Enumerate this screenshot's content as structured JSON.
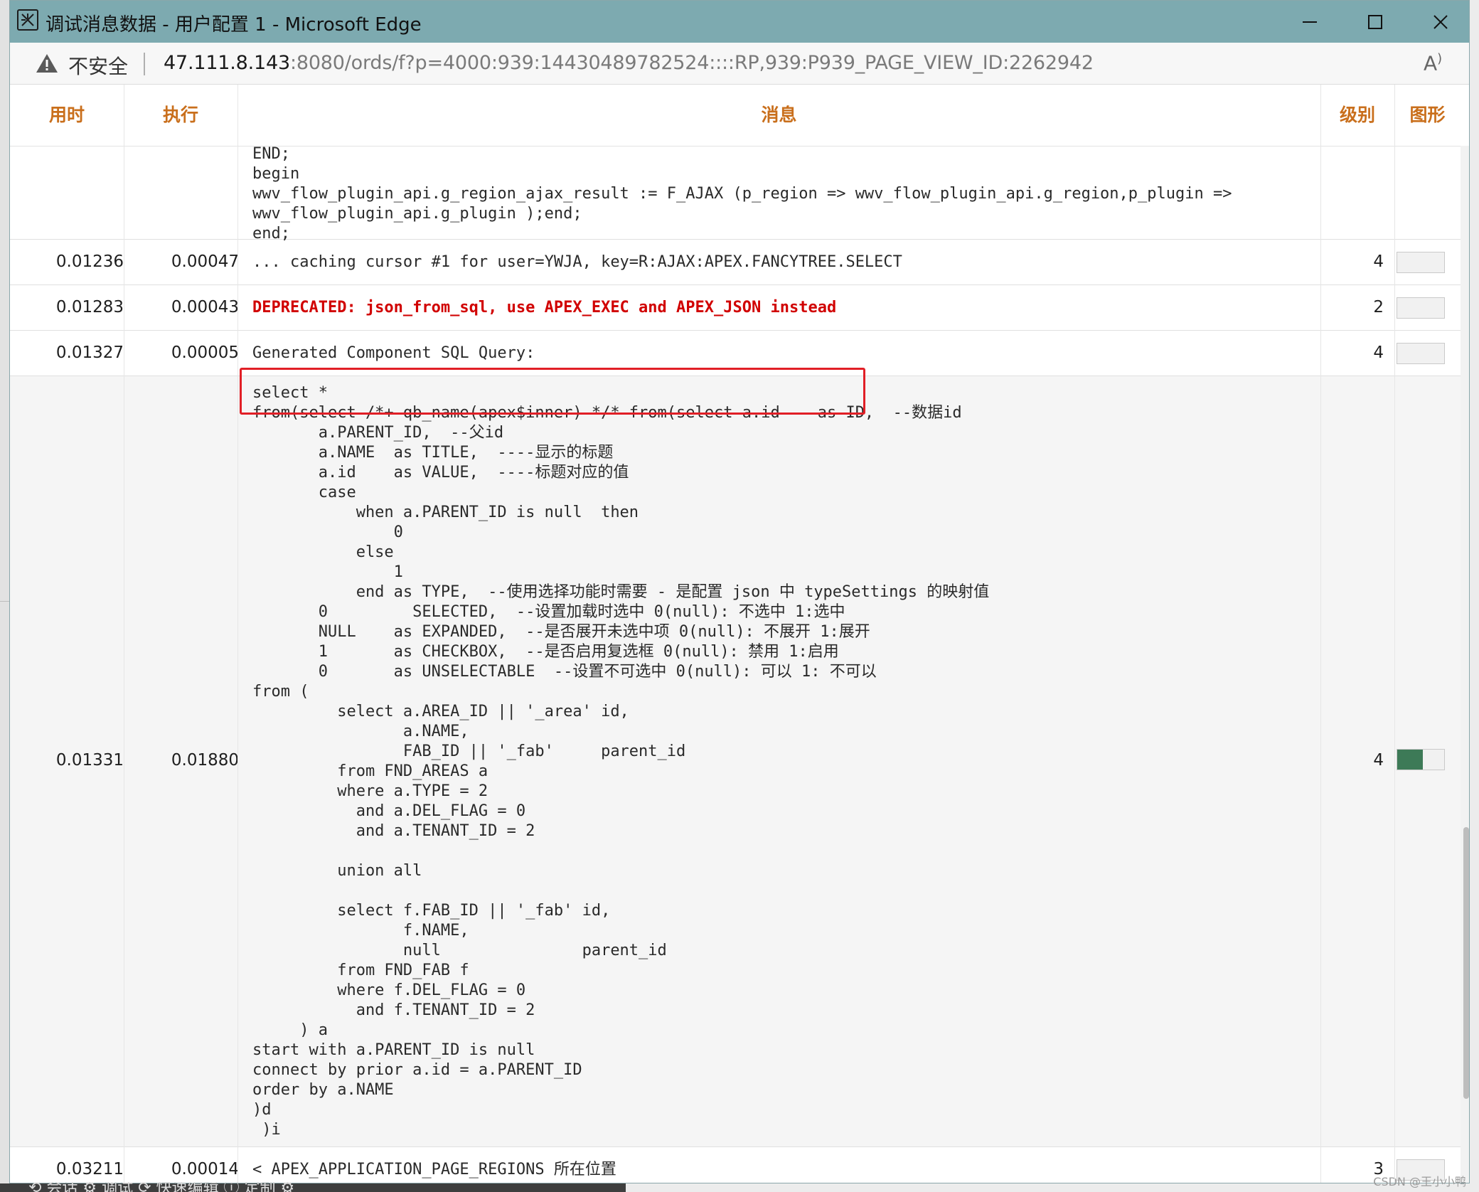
{
  "window": {
    "title": "调试消息数据 - 用户配置 1 - Microsoft Edge"
  },
  "addressbar": {
    "insecure_label": "不安全",
    "url_host": "47.111.8.143",
    "url_rest": ":8080/ords/f?p=4000:939:14430489782524::::RP,939:P939_PAGE_VIEW_ID:2262942"
  },
  "table": {
    "headers": {
      "elapsed": "用时",
      "execution": "执行",
      "message": "消息",
      "level": "级别",
      "graph": "图形"
    },
    "rows": [
      {
        "elapsed": "",
        "execution": "",
        "message": "END;\nbegin\nwwv_flow_plugin_api.g_region_ajax_result := F_AJAX (p_region => wwv_flow_plugin_api.g_region,p_plugin =>\nwwv_flow_plugin_api.g_plugin );end;\nend;",
        "level": "",
        "graph_fraction": null
      },
      {
        "elapsed": "0.01236",
        "execution": "0.00047",
        "message": "... caching cursor #1 for user=YWJA, key=R:AJAX:APEX.FANCYTREE.SELECT",
        "level": "4",
        "graph_fraction": 0
      },
      {
        "elapsed": "0.01283",
        "execution": "0.00043",
        "message": "DEPRECATED: json_from_sql, use APEX_EXEC and APEX_JSON instead",
        "level": "2",
        "graph_fraction": 0
      },
      {
        "elapsed": "0.01327",
        "execution": "0.00005",
        "message": "Generated Component SQL Query:",
        "level": "4",
        "graph_fraction": 0
      },
      {
        "elapsed": "0.01331",
        "execution": "0.01880",
        "message": "select *\nfrom(select /*+ qb_name(apex$inner) */* from(select a.id    as ID,  --数据id\n       a.PARENT_ID,  --父id\n       a.NAME  as TITLE,  ----显示的标题\n       a.id    as VALUE,  ----标题对应的值\n       case\n           when a.PARENT_ID is null  then\n               0\n           else\n               1\n           end as TYPE,  --使用选择功能时需要 - 是配置 json 中 typeSettings 的映射值\n       0         SELECTED,  --设置加载时选中 0(null): 不选中 1:选中\n       NULL    as EXPANDED,  --是否展开未选中项 0(null): 不展开 1:展开\n       1       as CHECKBOX,  --是否启用复选框 0(null): 禁用 1:启用\n       0       as UNSELECTABLE  --设置不可选中 0(null): 可以 1: 不可以\nfrom (\n         select a.AREA_ID || '_area' id,\n                a.NAME,\n                FAB_ID || '_fab'     parent_id\n         from FND_AREAS a\n         where a.TYPE = 2\n           and a.DEL_FLAG = 0\n           and a.TENANT_ID = 2\n\n         union all\n\n         select f.FAB_ID || '_fab' id,\n                f.NAME,\n                null               parent_id\n         from FND_FAB f\n         where f.DEL_FLAG = 0\n           and f.TENANT_ID = 2\n     ) a\nstart with a.PARENT_ID is null\nconnect by prior a.id = a.PARENT_ID\norder by a.NAME\n)d\n )i",
        "level": "4",
        "graph_fraction": 0.55
      },
      {
        "elapsed": "0.03211",
        "execution": "0.00014",
        "message": "< APEX_APPLICATION_PAGE_REGIONS 所在位置",
        "level": "3",
        "graph_fraction": 0
      }
    ]
  },
  "taskbar": {
    "text": "⟲ 会话   ⚙ 调试   ⟳ 快速编辑   ⓘ 定制   ⚙"
  },
  "watermark": "CSDN @王小小鸭",
  "colors": {
    "titlebar": "#7daab0",
    "header_text": "#c96f1c",
    "deprecated_text": "#d10000",
    "highlight_border": "#e11f26",
    "graph_fill": "#3d7a57"
  }
}
